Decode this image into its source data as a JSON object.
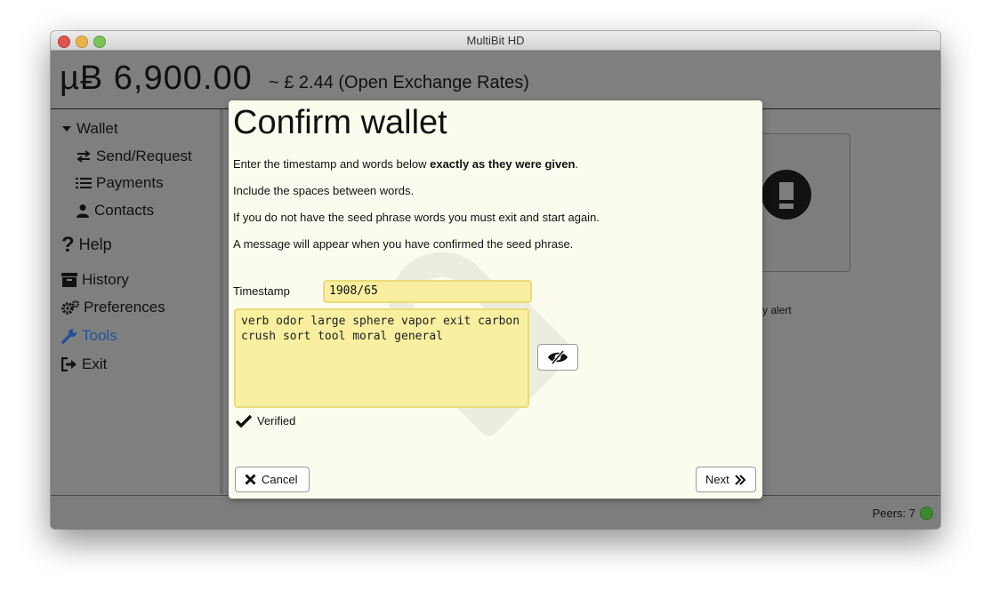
{
  "window": {
    "title": "MultiBit HD"
  },
  "header": {
    "balance": "µɃ 6,900.00",
    "fiat": "~ £ 2.44 (Open Exchange Rates)"
  },
  "sidebar": {
    "items": [
      {
        "label": "Wallet",
        "icon": "caret-down-icon"
      },
      {
        "label": "Send/Request",
        "icon": "exchange-icon"
      },
      {
        "label": "Payments",
        "icon": "list-icon"
      },
      {
        "label": "Contacts",
        "icon": "user-icon"
      },
      {
        "label": "Help",
        "icon": "question-icon"
      },
      {
        "label": "History",
        "icon": "archive-icon"
      },
      {
        "label": "Preferences",
        "icon": "gears-icon"
      },
      {
        "label": "Tools",
        "icon": "wrench-icon",
        "active": true
      },
      {
        "label": "Exit",
        "icon": "sign-out-icon"
      }
    ]
  },
  "background_card": {
    "label": "y alert"
  },
  "status": {
    "peers": "Peers: 7",
    "peer_color": "#3c8a2e"
  },
  "dialog": {
    "title": "Confirm wallet",
    "line1_prefix": "Enter the timestamp and words below ",
    "line1_bold": "exactly as they were given",
    "line1_suffix": ".",
    "line2": "Include the spaces between words.",
    "line3": "If you do not have the seed phrase words you must exit and start again.",
    "line4": "A message will appear when you have confirmed the seed phrase.",
    "timestamp_label": "Timestamp",
    "timestamp_value": "1908/65",
    "seed_phrase": "verb odor large sphere vapor exit carbon\ncrush sort tool moral general",
    "verified_label": "Verified",
    "cancel_label": "Cancel",
    "next_label": "Next"
  },
  "colors": {
    "accent": "#254f9c",
    "input_bg": "#f8efa0",
    "dialog_bg": "#fcfcee"
  }
}
